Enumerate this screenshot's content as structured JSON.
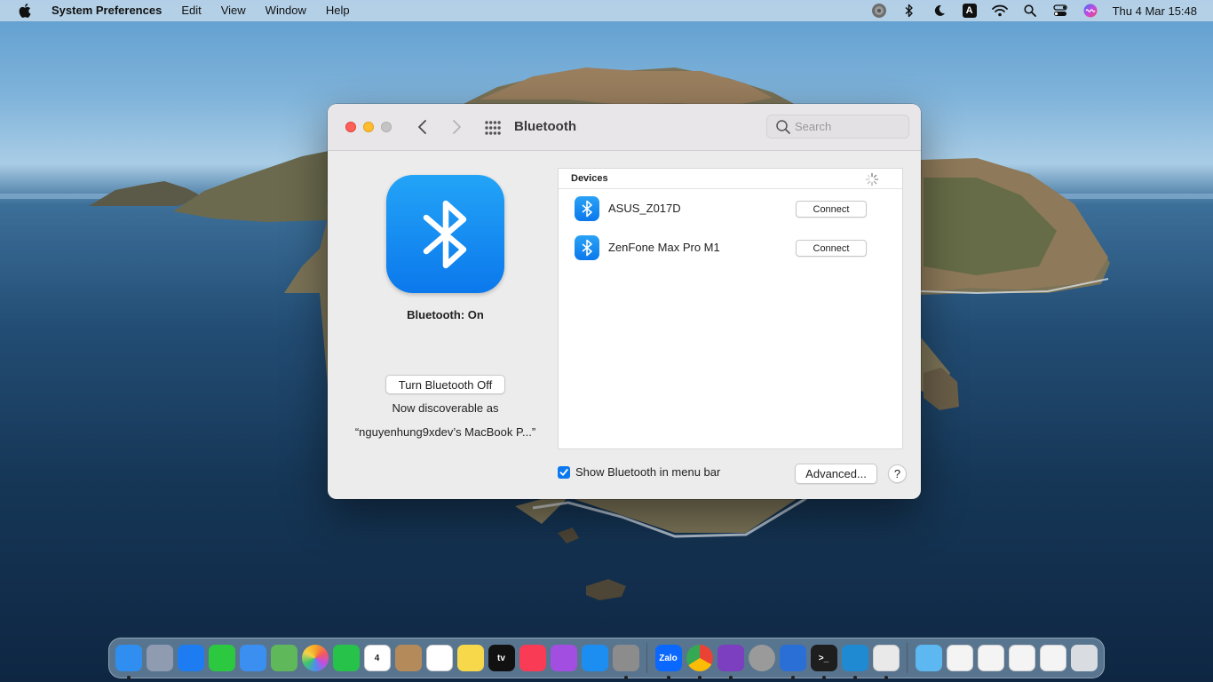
{
  "menubar": {
    "apple_icon": "apple-logo-icon",
    "app_name": "System Preferences",
    "menus": [
      "Edit",
      "View",
      "Window",
      "Help"
    ],
    "status_icons": [
      "user-circle-icon",
      "bluetooth-icon",
      "moon-icon",
      "input-source-icon",
      "wifi-icon",
      "spotlight-search-icon",
      "control-center-icon",
      "siri-icon"
    ],
    "input_source_letter": "A",
    "clock": "Thu 4 Mar  15:48"
  },
  "window": {
    "title": "Bluetooth",
    "search_placeholder": "Search",
    "bluetooth_status": "Bluetooth: On",
    "toggle_button": "Turn Bluetooth Off",
    "discoverable_line1": "Now discoverable as",
    "discoverable_line2": "“nguyenhung9xdev’s MacBook P...”",
    "devices_header": "Devices",
    "devices": [
      {
        "name": "ASUS_Z017D",
        "action": "Connect"
      },
      {
        "name": "ZenFone Max Pro M1",
        "action": "Connect"
      }
    ],
    "show_in_menubar_label": "Show Bluetooth in menu bar",
    "show_in_menubar_checked": true,
    "advanced_button": "Advanced...",
    "help_button": "?"
  },
  "dock": {
    "apps": [
      {
        "name": "finder",
        "label": "",
        "color": "#2f8ef0",
        "running": true
      },
      {
        "name": "launchpad",
        "label": "",
        "color": "#8e9bb0",
        "running": false
      },
      {
        "name": "safari",
        "label": "",
        "color": "#1d7cf2",
        "running": false
      },
      {
        "name": "messages",
        "label": "",
        "color": "#2bc840",
        "running": false
      },
      {
        "name": "mail",
        "label": "",
        "color": "#3a8ff0",
        "running": false
      },
      {
        "name": "maps",
        "label": "",
        "color": "#5fb85a",
        "running": false
      },
      {
        "name": "photos",
        "label": "",
        "color": "#f2f2f2",
        "running": false
      },
      {
        "name": "facetime",
        "label": "",
        "color": "#27c24a",
        "running": false
      },
      {
        "name": "calendar",
        "label": "4",
        "color": "#ffffff",
        "running": false
      },
      {
        "name": "contacts",
        "label": "",
        "color": "#b58a5a",
        "running": false
      },
      {
        "name": "reminders",
        "label": "",
        "color": "#ffffff",
        "running": false
      },
      {
        "name": "notes",
        "label": "",
        "color": "#f7d84a",
        "running": false
      },
      {
        "name": "apple-tv",
        "label": "tv",
        "color": "#111111",
        "running": false
      },
      {
        "name": "music",
        "label": "",
        "color": "#fa3b55",
        "running": false
      },
      {
        "name": "podcasts",
        "label": "",
        "color": "#a24ee0",
        "running": false
      },
      {
        "name": "app-store",
        "label": "",
        "color": "#1c8ef2",
        "running": false
      },
      {
        "name": "system-preferences",
        "label": "",
        "color": "#8c8c8c",
        "running": true
      },
      {
        "name": "separator",
        "label": "",
        "color": "",
        "running": false
      },
      {
        "name": "zalo",
        "label": "Zalo",
        "color": "#0a68ff",
        "running": true
      },
      {
        "name": "chrome",
        "label": "",
        "color": "#ffffff",
        "running": true
      },
      {
        "name": "github-desktop",
        "label": "",
        "color": "#7b3fbf",
        "running": true
      },
      {
        "name": "compressor",
        "label": "",
        "color": "#9a9a9a",
        "running": false
      },
      {
        "name": "xcode",
        "label": "",
        "color": "#2a6fd6",
        "running": true
      },
      {
        "name": "terminal",
        "label": ">_",
        "color": "#1e1e1e",
        "running": true
      },
      {
        "name": "vscode",
        "label": "",
        "color": "#1f8ad2",
        "running": true
      },
      {
        "name": "printer-utility",
        "label": "",
        "color": "#e9e9e9",
        "running": true
      },
      {
        "name": "separator",
        "label": "",
        "color": "",
        "running": false
      },
      {
        "name": "downloads-folder",
        "label": "",
        "color": "#5db7f0",
        "running": false
      },
      {
        "name": "document-1",
        "label": "",
        "color": "#f4f4f4",
        "running": false
      },
      {
        "name": "document-2",
        "label": "",
        "color": "#f4f4f4",
        "running": false
      },
      {
        "name": "document-3",
        "label": "",
        "color": "#f4f4f4",
        "running": false
      },
      {
        "name": "document-4",
        "label": "",
        "color": "#f4f4f4",
        "running": false
      },
      {
        "name": "trash",
        "label": "",
        "color": "#d9dde2",
        "running": false
      }
    ]
  },
  "colors": {
    "accent": "#0a78ee",
    "bluetooth_gradient_top": "#23a4f7",
    "bluetooth_gradient_bottom": "#0b78ec",
    "close": "#fe5f57",
    "minimize": "#febc2e",
    "maximize_disabled": "#c4c4c4"
  }
}
